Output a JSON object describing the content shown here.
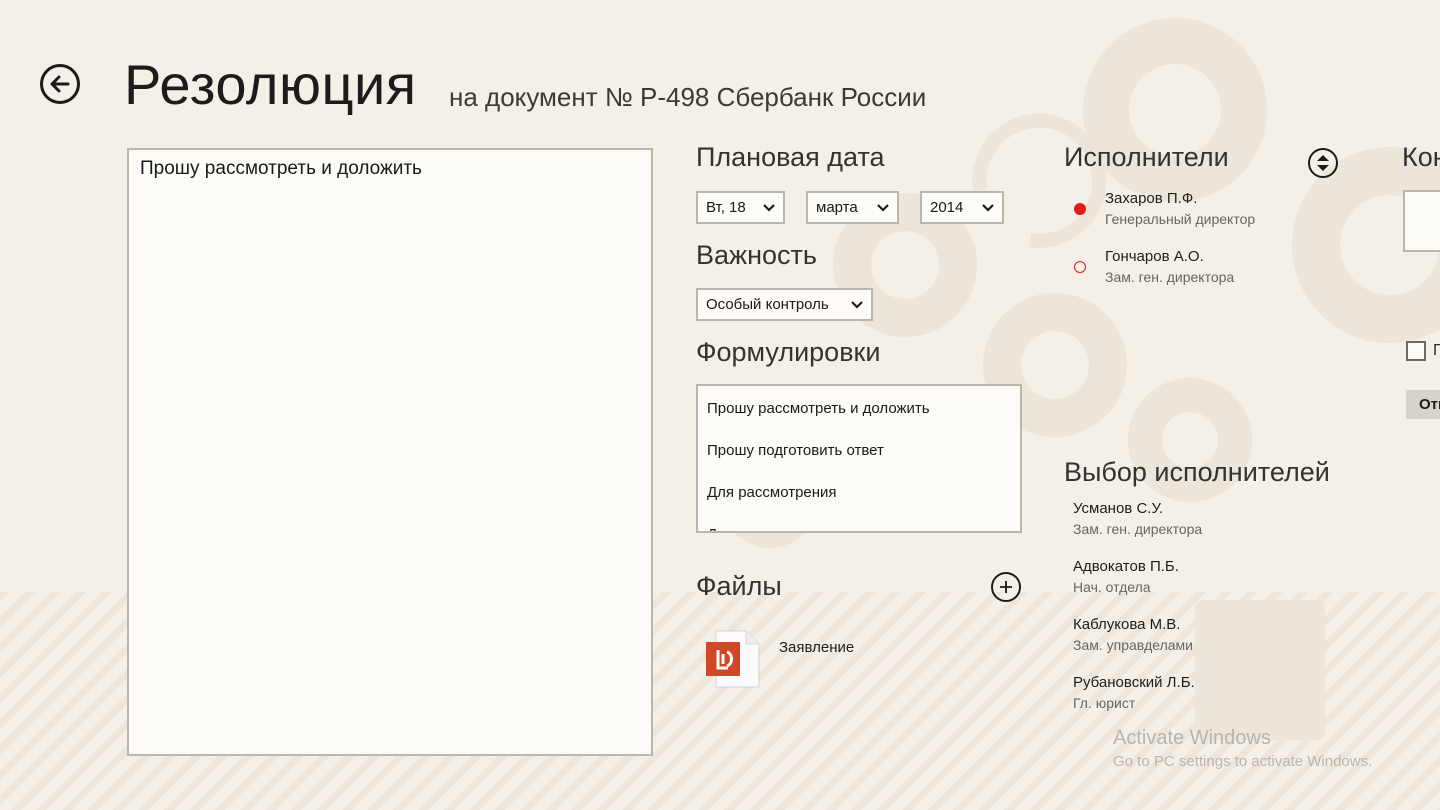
{
  "header": {
    "title": "Резолюция",
    "subtitle": "на документ № Р-498 Сбербанк России"
  },
  "resolution": {
    "text": "Прошу рассмотреть и доложить"
  },
  "planned_date": {
    "label": "Плановая дата",
    "day": "Вт, 18",
    "month": "марта",
    "year": "2014"
  },
  "importance": {
    "label": "Важность",
    "value": "Особый контроль"
  },
  "phrases": {
    "label": "Формулировки",
    "items": [
      "Прошу рассмотреть и доложить",
      "Прошу подготовить ответ",
      "Для рассмотрения",
      "Д"
    ]
  },
  "files": {
    "label": "Файлы",
    "items": [
      {
        "name": "Заявление"
      }
    ]
  },
  "executors": {
    "label": "Исполнители",
    "items": [
      {
        "name": "Захаров П.Ф.",
        "role": "Генеральный директор"
      },
      {
        "name": "Гончаров А.О.",
        "role": "Зам. ген. директора"
      }
    ]
  },
  "executor_choice": {
    "label": "Выбор исполнителей",
    "items": [
      {
        "name": "Усманов С.У.",
        "role": "Зам. ген. директора"
      },
      {
        "name": "Адвокатов П.Б.",
        "role": "Нач. отдела"
      },
      {
        "name": "Каблукова М.В.",
        "role": "Зам. управделами"
      },
      {
        "name": "Рубановский Л.Б.",
        "role": "Гл. юрист"
      }
    ]
  },
  "right_panel": {
    "label_partial": "Кон",
    "checkbox_partial": "П",
    "button_partial": "Отп"
  },
  "watermark": {
    "line1": "Activate Windows",
    "line2": "Go to PC settings to activate Windows."
  },
  "colors": {
    "accent_red": "#e31b1b",
    "file_icon_red": "#d24726",
    "background": "#f4efe7"
  },
  "icons": {
    "back": "back-arrow-icon",
    "reorder": "up-down-arrows-icon",
    "add": "plus-icon",
    "dropdown": "chevron-down-icon",
    "file": "pdf-file-icon"
  }
}
